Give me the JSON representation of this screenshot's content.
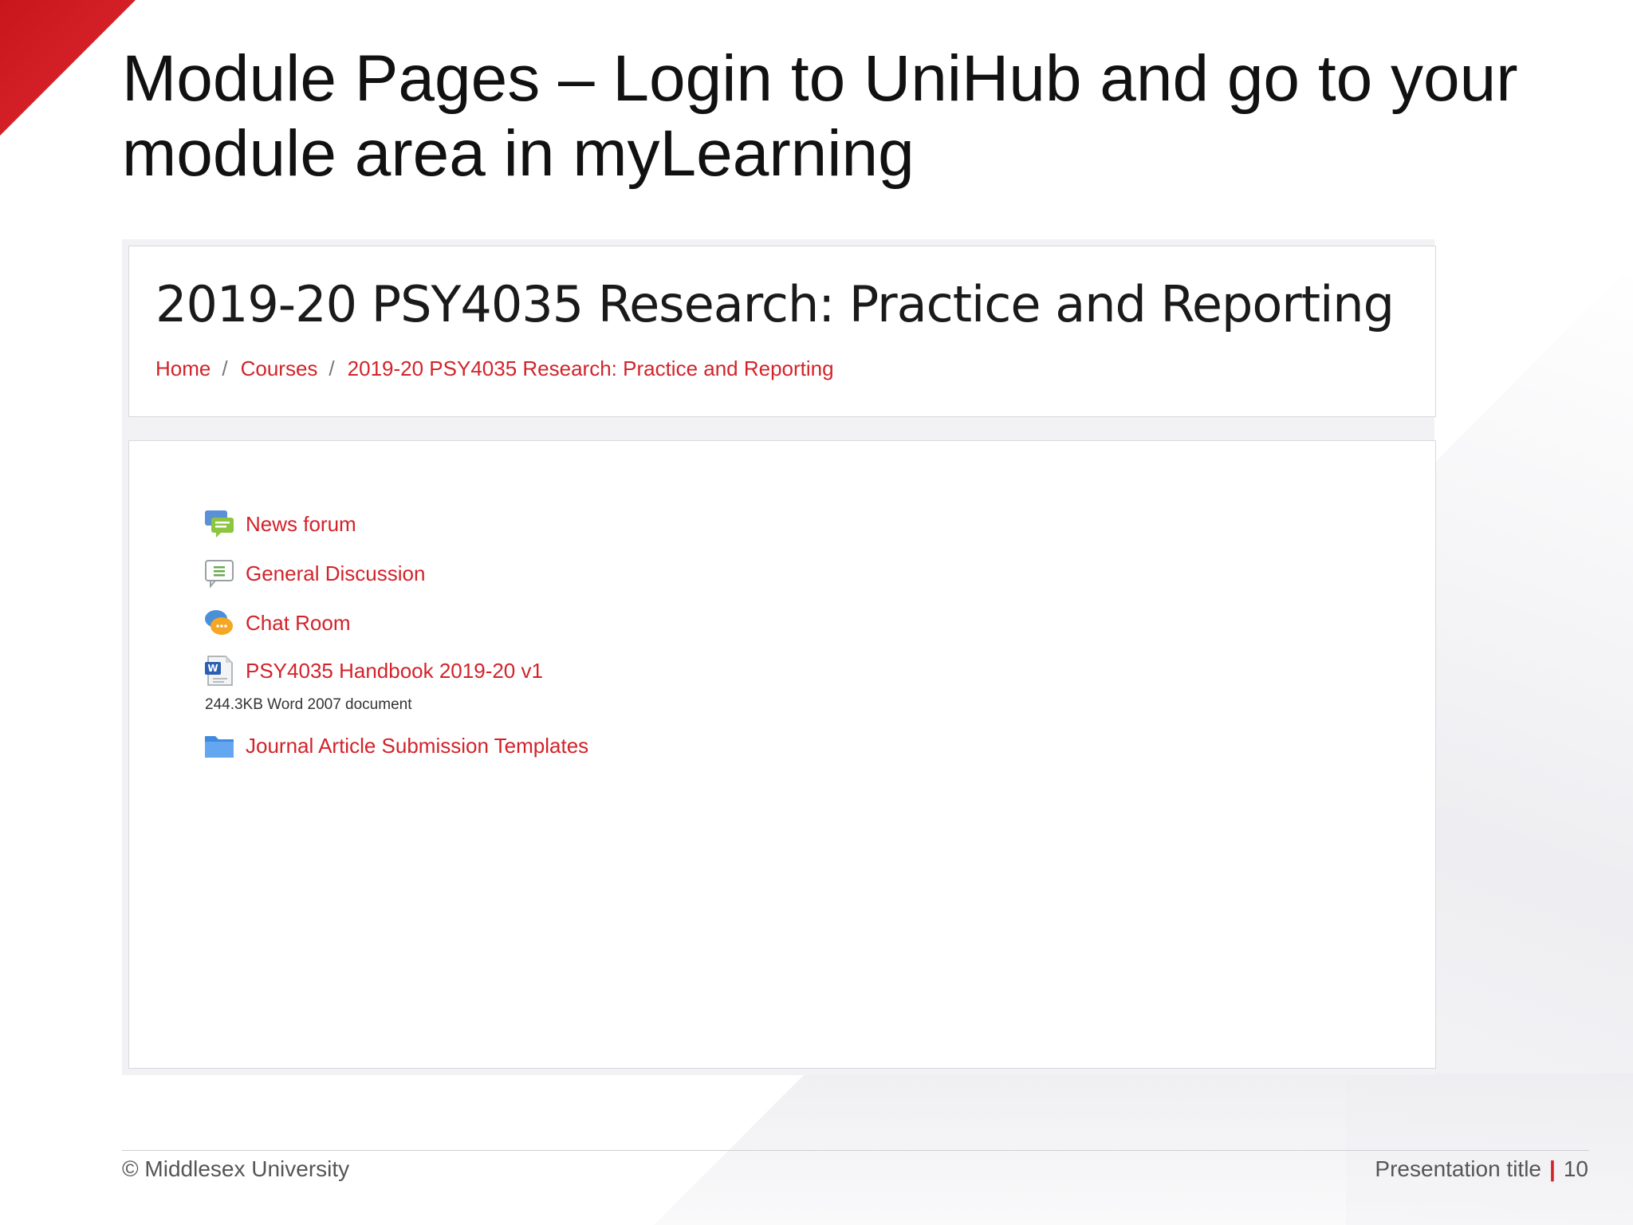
{
  "slide": {
    "title": "Module Pages – Login to UniHub and go to your module area in myLearning",
    "footer_copyright": "© Middlesex University",
    "footer_presentation_title": "Presentation title",
    "footer_separator": "|",
    "page_number": "10"
  },
  "course_page": {
    "title": "2019-20 PSY4035 Research: Practice and Reporting",
    "breadcrumb": [
      {
        "label": "Home"
      },
      {
        "label": "Courses"
      },
      {
        "label": "2019-20 PSY4035 Research: Practice and Reporting"
      }
    ],
    "breadcrumb_separator": "/",
    "activities": [
      {
        "label": "News forum",
        "icon": "forum-icon"
      },
      {
        "label": "General Discussion",
        "icon": "discussion-icon"
      },
      {
        "label": "Chat Room",
        "icon": "chat-icon"
      },
      {
        "label": "PSY4035 Handbook 2019-20 v1",
        "icon": "word-document-icon",
        "meta": "244.3KB Word 2007 document"
      },
      {
        "label": "Journal Article Submission Templates",
        "icon": "folder-icon"
      }
    ]
  },
  "colors": {
    "accent_red": "#d2232a",
    "corner_red": "#c8161d"
  }
}
